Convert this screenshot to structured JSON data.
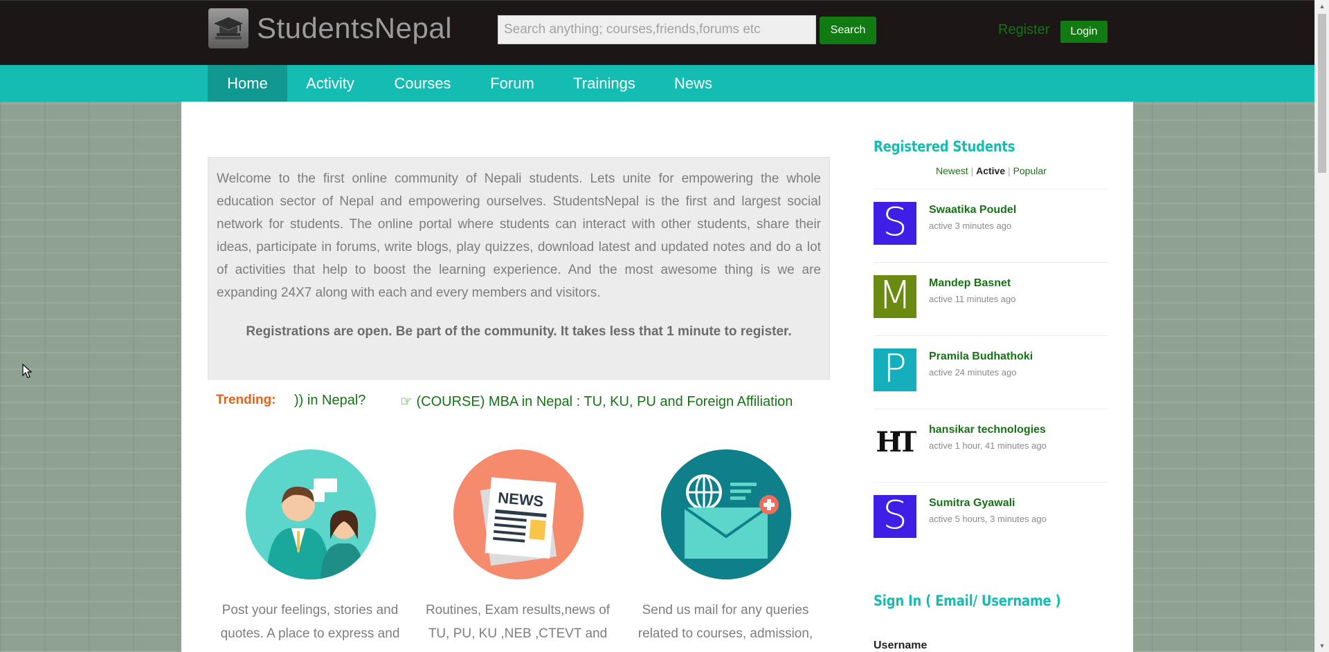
{
  "header": {
    "logo_text": "StudentsNepal",
    "search_placeholder": "Search anything; courses,friends,forums etc",
    "search_button": "Search",
    "register_link": "Register",
    "login_button": "Login"
  },
  "nav": {
    "items": [
      {
        "label": "Home",
        "active": true
      },
      {
        "label": "Activity"
      },
      {
        "label": "Courses"
      },
      {
        "label": "Forum"
      },
      {
        "label": "Trainings"
      },
      {
        "label": "News"
      }
    ]
  },
  "intro": {
    "text": "Welcome to the first online community of Nepali students. Lets unite for empowering the whole education sector of Nepal and empowering ourselves. StudentsNepal is the first and largest social network for students. The online portal where students can interact with other students, share their ideas, participate in forums, write blogs, play quizzes, download latest and updated notes and do a lot of activities that help to boost the learning experience. And the most awesome thing is we are expanding 24X7 along with each and every members and visitors.",
    "cta": "Registrations are open. Be part of the community. It takes less that 1 minute to register."
  },
  "trending": {
    "label": "Trending:",
    "items": [
      ")) in Nepal?",
      "☞ (COURSE) MBA in Nepal : TU, KU, PU and Foreign Affiliation"
    ]
  },
  "features": [
    {
      "icon": "people-chat-icon",
      "color": "#5cd6cb",
      "text": "Post your feelings, stories and quotes. A place to express and"
    },
    {
      "icon": "news-icon",
      "color": "#f68a6c",
      "text": "Routines, Exam results,news of TU, PU, KU ,NEB ,CTEVT and"
    },
    {
      "icon": "mail-globe-icon",
      "color": "#0f7f89",
      "text": "Send us mail for any queries related to courses, admission,"
    }
  ],
  "sidebar": {
    "registered_title": "Registered Students",
    "tabs": {
      "newest": "Newest",
      "active": "Active",
      "popular": "Popular",
      "sep": "|"
    },
    "members": [
      {
        "initial": "S",
        "color": "#3f1fe6",
        "name": "Swaatika Poudel",
        "active": "active 3 minutes ago"
      },
      {
        "initial": "M",
        "color": "#6b8a12",
        "name": "Mandep Basnet",
        "active": "active 11 minutes ago"
      },
      {
        "initial": "P",
        "color": "#14aebc",
        "name": "Pramila Budhathoki",
        "active": "active 24 minutes ago"
      },
      {
        "initial": "HT",
        "color": "#ffffff",
        "name": "hansikar technologies",
        "active": "active 1 hour, 41 minutes ago"
      },
      {
        "initial": "S",
        "color": "#3f1fe6",
        "name": "Sumitra Gyawali",
        "active": "active 5 hours, 3 minutes ago"
      }
    ],
    "signin_title": "Sign In ( Email/ Username )",
    "username_label": "Username"
  }
}
